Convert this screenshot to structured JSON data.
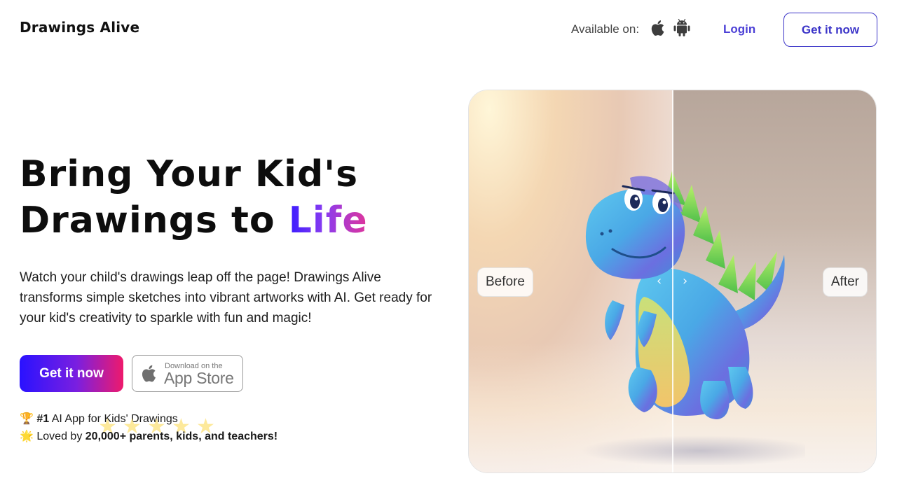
{
  "header": {
    "logo": "Drawings Alive",
    "available_label": "Available on:",
    "platforms": [
      "apple-icon",
      "android-icon"
    ],
    "login_label": "Login",
    "cta_label": "Get it now"
  },
  "hero": {
    "headline_line1": "Bring Your Kid's",
    "headline_line2_prefix": "Drawings to ",
    "headline_accent": "Life",
    "description": "Watch your child's drawings leap off the page! Drawings Alive transforms simple sketches into vibrant artworks with AI. Get ready for your kid's creativity to sparkle with fun and magic!",
    "cta_label": "Get it now",
    "app_store": {
      "small_text": "Download on the",
      "big_text": "App Store"
    },
    "proof": {
      "line1_icon": "🏆",
      "line1_bold": "#1",
      "line1_text": " AI App for Kids' Drawings",
      "line2_icon": "🌟",
      "line2_text": "Loved by ",
      "line2_bold": "20,000+ parents, kids, and teachers!"
    },
    "stars": [
      "★",
      "★",
      "★",
      "★",
      "★"
    ]
  },
  "compare": {
    "before_label": "Before",
    "after_label": "After",
    "arrow_left": "‹",
    "arrow_right": "›"
  },
  "colors": {
    "brand_primary": "#3b34c8",
    "gradient_start": "#2a12ff",
    "gradient_end": "#ee1a6c"
  }
}
